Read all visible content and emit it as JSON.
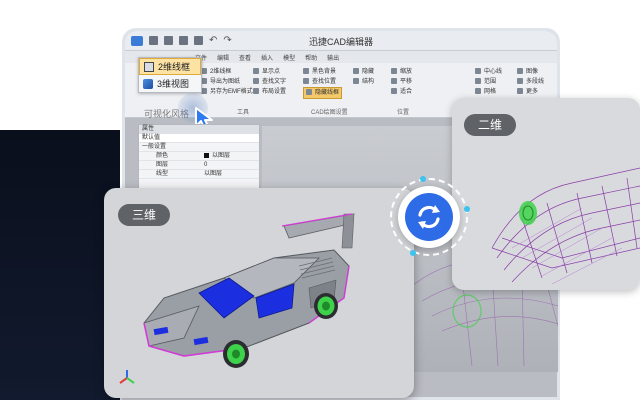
{
  "app": {
    "title": "迅捷CAD编辑器",
    "menus": [
      "文件",
      "编辑",
      "查看",
      "插入",
      "模型",
      "帮助",
      "输出"
    ]
  },
  "ribbon": {
    "groups": [
      {
        "items": [
          "2维线框",
          "导出为图纸",
          "另存为EMF格式"
        ]
      },
      {
        "items": [
          "显示点",
          "查找文字",
          "布局设置"
        ]
      },
      {
        "items": [
          "黑色背景",
          "查找位置",
          "隐藏线框"
        ]
      },
      {
        "items": [
          "隐藏",
          "结构"
        ]
      },
      {
        "items": [
          "缩放",
          "平移",
          "适合"
        ]
      },
      {
        "items": [
          "中心线",
          "范围",
          "网格"
        ]
      },
      {
        "items": [
          "图像",
          "多段线",
          "更多"
        ]
      }
    ],
    "group_labels": [
      "工具",
      "CAD绘图设置",
      "位置"
    ],
    "highlighted_button": "黑色背景"
  },
  "visual_style_menu": {
    "items": [
      {
        "label": "2维线框",
        "icon": "wireframe-icon",
        "selected": true
      },
      {
        "label": "3维视图",
        "icon": "3d-view-icon",
        "selected": false
      }
    ],
    "caption": "可视化风格"
  },
  "properties": {
    "header": "属性",
    "dropdown_value": "默认值",
    "section": "一般设置",
    "rows": [
      {
        "key": "颜色",
        "value": "以图层",
        "swatch": true
      },
      {
        "key": "图层",
        "value": "0"
      },
      {
        "key": "线型",
        "value": "以图层"
      }
    ]
  },
  "views": {
    "left_label": "三维",
    "right_label": "二维"
  },
  "colors": {
    "accent_blue": "#2e6be6",
    "car_body": "#9a9ea5",
    "car_glass": "#1b2fe0",
    "car_wheels": "#3ed24a",
    "car_edges": "#d23cd6",
    "wireframe": "#8a3da8",
    "dark_bg": "#0a0f1c"
  }
}
